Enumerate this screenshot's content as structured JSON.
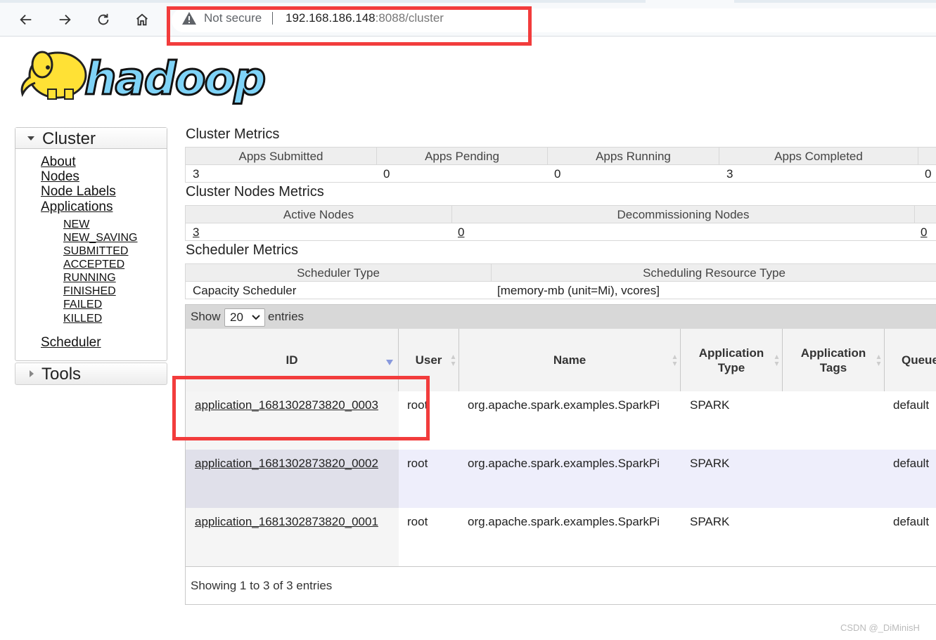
{
  "browser": {
    "security_label": "Not secure",
    "url_host": "192.168.186.148",
    "url_rest": ":8088/cluster"
  },
  "colors": {
    "highlight": "#f23c3c",
    "logo_yellow": "#ffe135",
    "logo_blue": "#7fd3f7"
  },
  "logo": {
    "alt": "hadoop"
  },
  "sidebar": {
    "cluster_title": "Cluster",
    "links": [
      "About",
      "Nodes",
      "Node Labels",
      "Applications"
    ],
    "states": [
      "NEW",
      "NEW_SAVING",
      "SUBMITTED",
      "ACCEPTED",
      "RUNNING",
      "FINISHED",
      "FAILED",
      "KILLED"
    ],
    "scheduler": "Scheduler",
    "tools_title": "Tools"
  },
  "cluster_metrics": {
    "title": "Cluster Metrics",
    "headers": [
      "Apps Submitted",
      "Apps Pending",
      "Apps Running",
      "Apps Completed"
    ],
    "values": [
      "3",
      "0",
      "0",
      "3",
      "0"
    ]
  },
  "node_metrics": {
    "title": "Cluster Nodes Metrics",
    "headers": [
      "Active Nodes",
      "Decommissioning Nodes"
    ],
    "values": [
      "3",
      "0",
      "0"
    ]
  },
  "scheduler_metrics": {
    "title": "Scheduler Metrics",
    "headers": [
      "Scheduler Type",
      "Scheduling Resource Type"
    ],
    "values": [
      "Capacity Scheduler",
      "[memory-mb (unit=Mi), vcores]"
    ]
  },
  "apps_table": {
    "show_label": "Show",
    "page_size": "20",
    "entries_label": "entries",
    "columns": [
      "ID",
      "User",
      "Name",
      "Application Type",
      "Application Tags",
      "Queue"
    ],
    "rows": [
      {
        "id": "application_1681302873820_0003",
        "user": "root",
        "name": "org.apache.spark.examples.SparkPi",
        "type": "SPARK",
        "tags": "",
        "queue": "default"
      },
      {
        "id": "application_1681302873820_0002",
        "user": "root",
        "name": "org.apache.spark.examples.SparkPi",
        "type": "SPARK",
        "tags": "",
        "queue": "default"
      },
      {
        "id": "application_1681302873820_0001",
        "user": "root",
        "name": "org.apache.spark.examples.SparkPi",
        "type": "SPARK",
        "tags": "",
        "queue": "default"
      }
    ],
    "footer": "Showing 1 to 3 of 3 entries"
  },
  "watermark": "CSDN @_DiMinisH"
}
